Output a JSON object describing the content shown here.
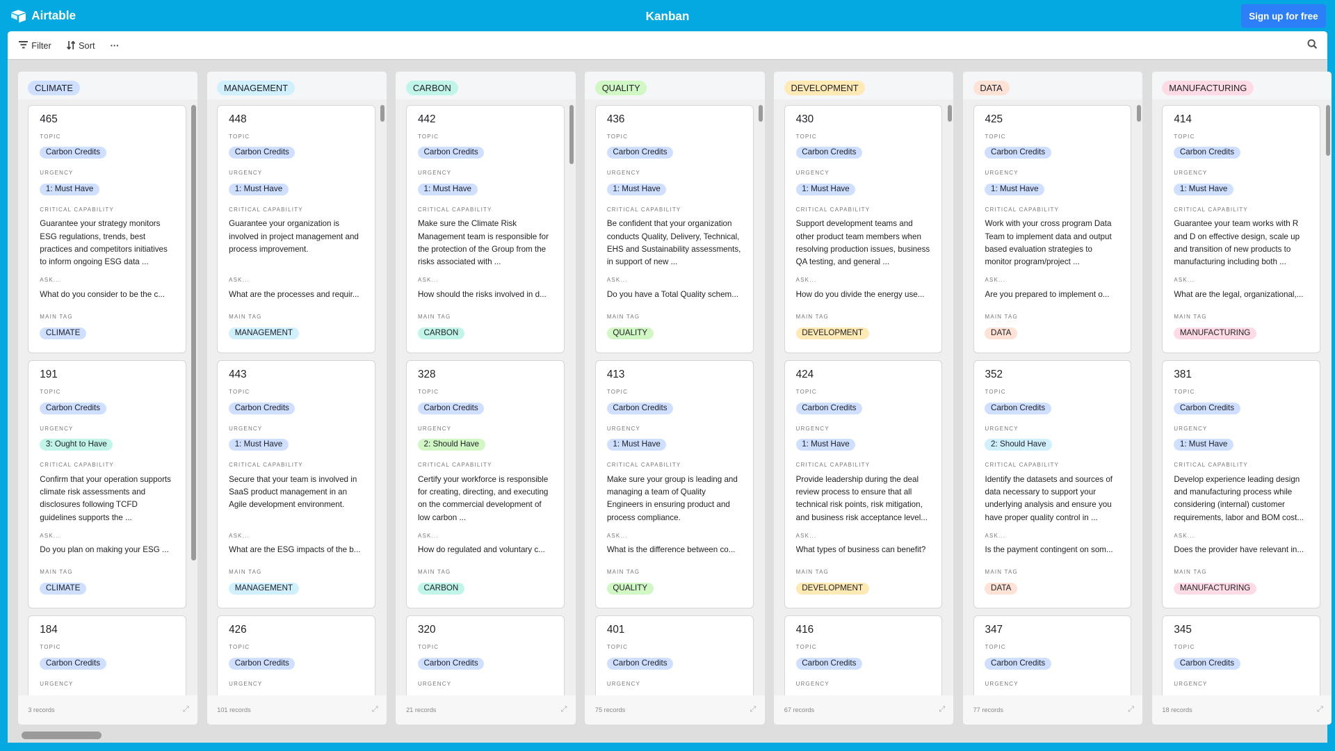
{
  "header": {
    "app_name": "Airtable",
    "title": "Kanban",
    "signup_label": "Sign up for free"
  },
  "toolbar": {
    "filter_label": "Filter",
    "sort_label": "Sort",
    "more_label": "···"
  },
  "labels": {
    "topic": "TOPIC",
    "urgency": "URGENCY",
    "capability": "CRITICAL CAPABILITY",
    "ask": "ASK...",
    "main_tag": "MAIN TAG"
  },
  "colors": {
    "accent": "#03a9e0",
    "signup": "#2d7ff9",
    "pill_blue": "#cfdfff",
    "must": "#cfdfff",
    "ought": "#c2f5e9",
    "should_green": "#d1f7c4",
    "should_blue": "#d0f0fd"
  },
  "columns": [
    {
      "name": "CLIMATE",
      "color": "#cfdfff",
      "records": "3 records",
      "cards": [
        {
          "num": "465",
          "topic": "Carbon Credits",
          "urgency": "1: Must Have",
          "ucolor": "#cfdfff",
          "cap": "Guarantee your strategy monitors ESG regulations, trends, best practices and competitors initiatives to inform ongoing ESG data ...",
          "ask": "What do you consider to be the c...",
          "tag": "CLIMATE"
        },
        {
          "num": "191",
          "topic": "Carbon Credits",
          "urgency": "3: Ought to Have",
          "ucolor": "#c2f5e9",
          "cap": "Confirm that your operation supports climate risk assessments and disclosures following TCFD guidelines supports the ...",
          "ask": "Do you plan on making your ESG ...",
          "tag": "CLIMATE"
        },
        {
          "num": "184",
          "topic": "Carbon Credits"
        }
      ]
    },
    {
      "name": "MANAGEMENT",
      "color": "#d0f0fd",
      "records": "101 records",
      "cards": [
        {
          "num": "448",
          "topic": "Carbon Credits",
          "urgency": "1: Must Have",
          "ucolor": "#cfdfff",
          "cap": "Guarantee your organization is involved in project management and process improvement.",
          "ask": "What are the processes and requir...",
          "tag": "MANAGEMENT"
        },
        {
          "num": "443",
          "topic": "Carbon Credits",
          "urgency": "1: Must Have",
          "ucolor": "#cfdfff",
          "cap": "Secure that your team is involved in SaaS product management in an Agile development environment.",
          "ask": "What are the ESG impacts of the b...",
          "tag": "MANAGEMENT"
        },
        {
          "num": "426",
          "topic": "Carbon Credits"
        }
      ]
    },
    {
      "name": "CARBON",
      "color": "#c2f5e9",
      "records": "21 records",
      "cards": [
        {
          "num": "442",
          "topic": "Carbon Credits",
          "urgency": "1: Must Have",
          "ucolor": "#cfdfff",
          "cap": "Make sure the Climate Risk Management team is responsible for the protection of the Group from the risks associated with ...",
          "ask": "How should the risks involved in d...",
          "tag": "CARBON"
        },
        {
          "num": "328",
          "topic": "Carbon Credits",
          "urgency": "2: Should Have",
          "ucolor": "#d1f7c4",
          "cap": "Certify your workforce is responsible for creating, directing, and executing on the commercial development of low carbon ...",
          "ask": "How do regulated and voluntary c...",
          "tag": "CARBON"
        },
        {
          "num": "320",
          "topic": "Carbon Credits"
        }
      ]
    },
    {
      "name": "QUALITY",
      "color": "#d1f7c4",
      "records": "75 records",
      "cards": [
        {
          "num": "436",
          "topic": "Carbon Credits",
          "urgency": "1: Must Have",
          "ucolor": "#cfdfff",
          "cap": "Be confident that your organization conducts Quality, Delivery, Technical, EHS and Sustainability assessments, in support of new ...",
          "ask": "Do you have a Total Quality schem...",
          "tag": "QUALITY"
        },
        {
          "num": "413",
          "topic": "Carbon Credits",
          "urgency": "1: Must Have",
          "ucolor": "#cfdfff",
          "cap": "Make sure your group is leading and managing a team of Quality Engineers in ensuring product and process compliance.",
          "ask": "What is the difference between co...",
          "tag": "QUALITY"
        },
        {
          "num": "401",
          "topic": "Carbon Credits"
        }
      ]
    },
    {
      "name": "DEVELOPMENT",
      "color": "#ffeab6",
      "records": "67 records",
      "cards": [
        {
          "num": "430",
          "topic": "Carbon Credits",
          "urgency": "1: Must Have",
          "ucolor": "#cfdfff",
          "cap": "Support development teams and other product team members when resolving production issues, business QA testing, and general ...",
          "ask": "How do you divide the energy use...",
          "tag": "DEVELOPMENT"
        },
        {
          "num": "424",
          "topic": "Carbon Credits",
          "urgency": "1: Must Have",
          "ucolor": "#cfdfff",
          "cap": "Provide leadership during the deal review process to ensure that all technical risk points, risk mitigation, and business risk acceptance level...",
          "ask": "What types of business can benefit?",
          "tag": "DEVELOPMENT"
        },
        {
          "num": "416",
          "topic": "Carbon Credits"
        }
      ]
    },
    {
      "name": "DATA",
      "color": "#fee2d5",
      "records": "77 records",
      "cards": [
        {
          "num": "425",
          "topic": "Carbon Credits",
          "urgency": "1: Must Have",
          "ucolor": "#cfdfff",
          "cap": "Work with your cross program Data Team to implement data and output based evaluation strategies to monitor program/project ...",
          "ask": "Are you prepared to implement o...",
          "tag": "DATA"
        },
        {
          "num": "352",
          "topic": "Carbon Credits",
          "urgency": "2: Should Have",
          "ucolor": "#d0f0fd",
          "cap": "Identify the datasets and sources of data necessary to support your underlying analysis and ensure you have proper quality control in ...",
          "ask": "Is the payment contingent on som...",
          "tag": "DATA"
        },
        {
          "num": "347",
          "topic": "Carbon Credits"
        }
      ]
    },
    {
      "name": "MANUFACTURING",
      "color": "#ffdce5",
      "records": "18 records",
      "cards": [
        {
          "num": "414",
          "topic": "Carbon Credits",
          "urgency": "1: Must Have",
          "ucolor": "#cfdfff",
          "cap": "Guarantee your team works with R and D on effective design, scale up and transition of new products to manufacturing including both ...",
          "ask": "What are the legal, organizational,...",
          "tag": "MANUFACTURING"
        },
        {
          "num": "381",
          "topic": "Carbon Credits",
          "urgency": "1: Must Have",
          "ucolor": "#cfdfff",
          "cap": "Develop experience leading design and manufacturing process while considering (internal) customer requirements, labor and BOM cost...",
          "ask": "Does the provider have relevant in...",
          "tag": "MANUFACTURING"
        },
        {
          "num": "345",
          "topic": "Carbon Credits"
        }
      ]
    }
  ]
}
